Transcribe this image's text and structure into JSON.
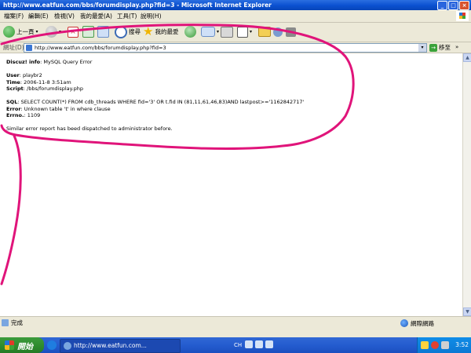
{
  "window": {
    "title": "http://www.eatfun.com/bbs/forumdisplay.php?fid=3 - Microsoft Internet Explorer"
  },
  "menu": [
    "檔案(F)",
    "編輯(E)",
    "檢視(V)",
    "我的最愛(A)",
    "工具(T)",
    "說明(H)"
  ],
  "toolbar": {
    "back_label": "上一頁",
    "search_label": "搜尋",
    "favorites_label": "我的最愛"
  },
  "address": {
    "label": "網址(D)",
    "url": "http://www.eatfun.com/bbs/forumdisplay.php?fid=3",
    "go_label": "移至",
    "links_label": "»"
  },
  "error": {
    "title_key": "Discuz! info",
    "title_value": "MySQL Query Error",
    "user_key": "User",
    "user_value": "playbr2",
    "time_key": "Time",
    "time_value": "2006-11-8 3:51am",
    "script_key": "Script",
    "script_value": "/bbs/forumdisplay.php",
    "sql_key": "SQL",
    "sql_value": "SELECT COUNT(*) FROM cdb_threads WHERE fid='3' OR t.fid IN (81,11,61,46,83)AND lastpost>='1162842717'",
    "error_key": "Error",
    "error_value": "Unknown table 't' in where clause",
    "errno_key": "Errno.",
    "errno_value": "1109",
    "footer": "Similar error report has beed dispatched to administrator before."
  },
  "status": {
    "text": "完成",
    "zone": "網際網路"
  },
  "taskbar": {
    "start_label": "開始",
    "task_label": "http://www.eatfun.com...",
    "lang": "CH",
    "clock": "3:52"
  },
  "colors": {
    "annotation": "#e0147a",
    "title_bar": "#0a50d0",
    "start_button": "#2d8a2d"
  }
}
